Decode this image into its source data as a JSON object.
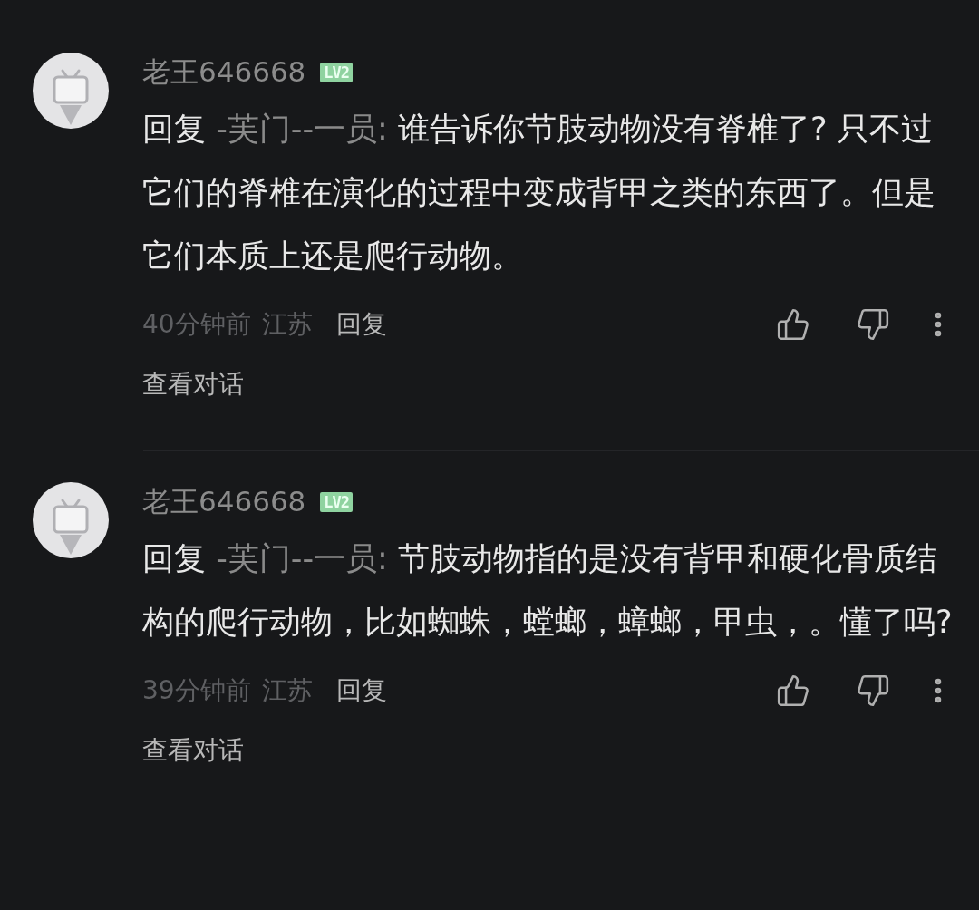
{
  "comments": [
    {
      "username": "老王646668",
      "level_badge": "LV2",
      "reply_label": "回复",
      "mention": "-芙门--一员:",
      "text": " 谁告诉你节肢动物没有脊椎了? 只不过它们的脊椎在演化的过程中变成背甲之类的东西了。但是它们本质上还是爬行动物。",
      "time": "40分钟前",
      "location": "江苏",
      "reply_button": "回复",
      "view_conversation": "查看对话"
    },
    {
      "username": "老王646668",
      "level_badge": "LV2",
      "reply_label": "回复",
      "mention": "-芙门--一员:",
      "text": " 节肢动物指的是没有背甲和硬化骨质结构的爬行动物，比如蜘蛛，螳螂，蟑螂，甲虫，。懂了吗?",
      "time": "39分钟前",
      "location": "江苏",
      "reply_button": "回复",
      "view_conversation": "查看对话"
    }
  ]
}
